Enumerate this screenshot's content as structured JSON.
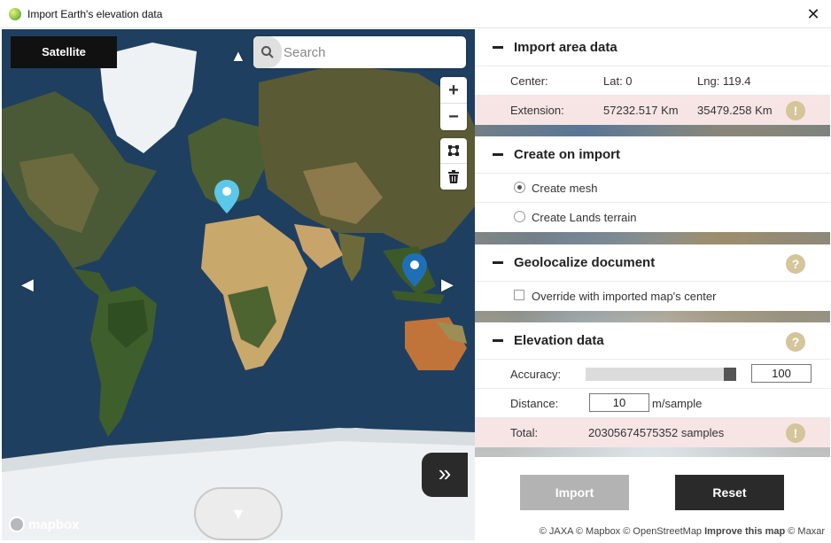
{
  "window": {
    "title": "Import Earth's elevation data",
    "close_label": "✕"
  },
  "map": {
    "satellite_label": "Satellite",
    "search_placeholder": "Search",
    "zoom_in": "+",
    "zoom_out": "−",
    "expand_label": "»",
    "down_label": "▼",
    "left_arrow": "◀",
    "right_arrow": "▶",
    "up_arrow": "▲",
    "logo_text": "mapbox"
  },
  "import_area": {
    "title": "Import area data",
    "center_label": "Center:",
    "lat": "Lat: 0",
    "lng": "Lng: 119.4",
    "extension_label": "Extension:",
    "extension_x": "57232.517 Km",
    "extension_y": "35479.258 Km",
    "warn": "!"
  },
  "create_on_import": {
    "title": "Create on import",
    "options": [
      {
        "label": "Create mesh",
        "selected": true
      },
      {
        "label": "Create Lands terrain",
        "selected": false
      }
    ]
  },
  "geolocalize": {
    "title": "Geolocalize document",
    "help": "?",
    "override_label": "Override with imported map's center"
  },
  "elevation": {
    "title": "Elevation data",
    "help": "?",
    "accuracy_label": "Accuracy:",
    "accuracy_value": "100",
    "accuracy_fraction": 1.0,
    "distance_label": "Distance:",
    "distance_value": "10",
    "distance_unit": "m/sample",
    "total_label": "Total:",
    "total_value": "20305674575352 samples",
    "warn": "!"
  },
  "footer": {
    "import_label": "Import",
    "reset_label": "Reset",
    "attribution": "© JAXA © Mapbox © OpenStreetMap",
    "improve_link": "Improve this map",
    "maxar": "© Maxar"
  },
  "colors": {
    "accent_help": "#d4c59a",
    "warn_row": "#f7e5e5",
    "dark_button": "#2a2a2a",
    "disabled_button": "#b3b3b3"
  }
}
